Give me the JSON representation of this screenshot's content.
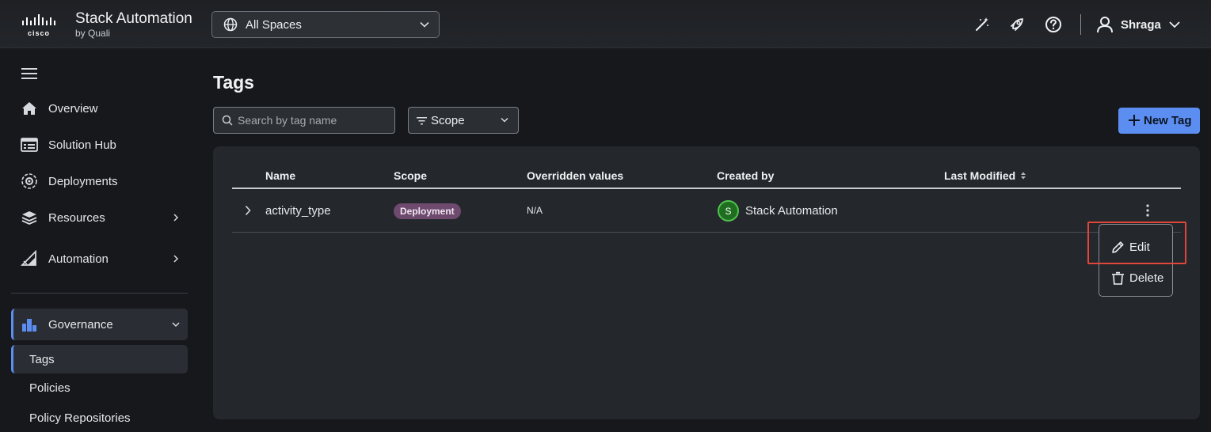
{
  "brand": {
    "title": "Stack Automation",
    "subtitle": "by Quali",
    "logo_text": "cisco"
  },
  "spaces_selector": {
    "label": "All Spaces"
  },
  "user": {
    "name": "Shraga"
  },
  "sidebar": {
    "items": [
      {
        "label": "Overview",
        "icon": "home-icon"
      },
      {
        "label": "Solution Hub",
        "icon": "solution-hub-icon"
      },
      {
        "label": "Deployments",
        "icon": "deployments-icon"
      },
      {
        "label": "Resources",
        "icon": "resources-icon"
      },
      {
        "label": "Automation",
        "icon": "automation-icon"
      },
      {
        "label": "Governance",
        "icon": "governance-icon"
      }
    ],
    "governance_sub": [
      {
        "label": "Tags",
        "active": true
      },
      {
        "label": "Policies"
      },
      {
        "label": "Policy Repositories"
      }
    ]
  },
  "page": {
    "title": "Tags",
    "search_placeholder": "Search by tag name",
    "scope_filter": "Scope",
    "new_tag_label": "New Tag"
  },
  "table": {
    "columns": [
      "Name",
      "Scope",
      "Overridden values",
      "Created by",
      "Last Modified"
    ],
    "rows": [
      {
        "name": "activity_type",
        "scope": "Deployment",
        "overridden": "N/A",
        "creator_initial": "S",
        "created_by": "Stack Automation"
      }
    ]
  },
  "context_menu": {
    "edit": "Edit",
    "delete": "Delete"
  },
  "colors": {
    "accent": "#5b8ef0",
    "badge": "#6e4a6e",
    "avatar": "#1f6e1f",
    "highlight": "#e0473a"
  }
}
